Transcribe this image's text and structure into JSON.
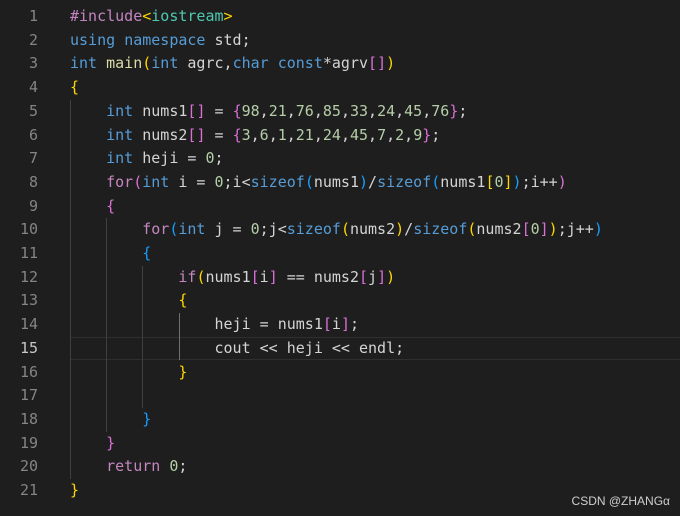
{
  "lines": [
    {
      "n": "1",
      "segs": [
        [
          "pp",
          "#include"
        ],
        [
          "b1",
          "<"
        ],
        [
          "ty",
          "iostream"
        ],
        [
          "b1",
          ">"
        ]
      ]
    },
    {
      "n": "2",
      "segs": [
        [
          "kw",
          "using"
        ],
        [
          "plain",
          " "
        ],
        [
          "kw",
          "namespace"
        ],
        [
          "plain",
          " std;"
        ]
      ]
    },
    {
      "n": "3",
      "segs": [
        [
          "kw",
          "int"
        ],
        [
          "plain",
          " "
        ],
        [
          "fn",
          "main"
        ],
        [
          "b1",
          "("
        ],
        [
          "kw",
          "int"
        ],
        [
          "plain",
          " agrc,"
        ],
        [
          "kw",
          "char"
        ],
        [
          "plain",
          " "
        ],
        [
          "kw",
          "const"
        ],
        [
          "plain",
          "*agrv"
        ],
        [
          "b2",
          "["
        ],
        [
          "b2",
          "]"
        ],
        [
          "b1",
          ")"
        ]
      ]
    },
    {
      "n": "4",
      "segs": [
        [
          "b1",
          "{"
        ]
      ]
    },
    {
      "n": "5",
      "segs": [
        [
          "plain",
          "    "
        ],
        [
          "kw",
          "int"
        ],
        [
          "plain",
          " nums1"
        ],
        [
          "b2",
          "["
        ],
        [
          "b2",
          "]"
        ],
        [
          "plain",
          " = "
        ],
        [
          "b2",
          "{"
        ],
        [
          "num",
          "98"
        ],
        [
          "plain",
          ","
        ],
        [
          "num",
          "21"
        ],
        [
          "plain",
          ","
        ],
        [
          "num",
          "76"
        ],
        [
          "plain",
          ","
        ],
        [
          "num",
          "85"
        ],
        [
          "plain",
          ","
        ],
        [
          "num",
          "33"
        ],
        [
          "plain",
          ","
        ],
        [
          "num",
          "24"
        ],
        [
          "plain",
          ","
        ],
        [
          "num",
          "45"
        ],
        [
          "plain",
          ","
        ],
        [
          "num",
          "76"
        ],
        [
          "b2",
          "}"
        ],
        [
          "plain",
          ";"
        ]
      ]
    },
    {
      "n": "6",
      "segs": [
        [
          "plain",
          "    "
        ],
        [
          "kw",
          "int"
        ],
        [
          "plain",
          " nums2"
        ],
        [
          "b2",
          "["
        ],
        [
          "b2",
          "]"
        ],
        [
          "plain",
          " = "
        ],
        [
          "b2",
          "{"
        ],
        [
          "num",
          "3"
        ],
        [
          "plain",
          ","
        ],
        [
          "num",
          "6"
        ],
        [
          "plain",
          ","
        ],
        [
          "num",
          "1"
        ],
        [
          "plain",
          ","
        ],
        [
          "num",
          "21"
        ],
        [
          "plain",
          ","
        ],
        [
          "num",
          "24"
        ],
        [
          "plain",
          ","
        ],
        [
          "num",
          "45"
        ],
        [
          "plain",
          ","
        ],
        [
          "num",
          "7"
        ],
        [
          "plain",
          ","
        ],
        [
          "num",
          "2"
        ],
        [
          "plain",
          ","
        ],
        [
          "num",
          "9"
        ],
        [
          "b2",
          "}"
        ],
        [
          "plain",
          ";"
        ]
      ]
    },
    {
      "n": "7",
      "segs": [
        [
          "plain",
          "    "
        ],
        [
          "kw",
          "int"
        ],
        [
          "plain",
          " heji = "
        ],
        [
          "num",
          "0"
        ],
        [
          "plain",
          ";"
        ]
      ]
    },
    {
      "n": "8",
      "segs": [
        [
          "plain",
          "    "
        ],
        [
          "ctl",
          "for"
        ],
        [
          "b2",
          "("
        ],
        [
          "kw",
          "int"
        ],
        [
          "plain",
          " i = "
        ],
        [
          "num",
          "0"
        ],
        [
          "plain",
          ";i<"
        ],
        [
          "kw",
          "sizeof"
        ],
        [
          "b3",
          "("
        ],
        [
          "plain",
          "nums1"
        ],
        [
          "b3",
          ")"
        ],
        [
          "plain",
          "/"
        ],
        [
          "kw",
          "sizeof"
        ],
        [
          "b3",
          "("
        ],
        [
          "plain",
          "nums1"
        ],
        [
          "b1",
          "["
        ],
        [
          "num",
          "0"
        ],
        [
          "b1",
          "]"
        ],
        [
          "b3",
          ")"
        ],
        [
          "plain",
          ";i++"
        ],
        [
          "b2",
          ")"
        ]
      ]
    },
    {
      "n": "9",
      "segs": [
        [
          "plain",
          "    "
        ],
        [
          "b2",
          "{"
        ]
      ]
    },
    {
      "n": "10",
      "segs": [
        [
          "plain",
          "        "
        ],
        [
          "ctl",
          "for"
        ],
        [
          "b3",
          "("
        ],
        [
          "kw",
          "int"
        ],
        [
          "plain",
          " j = "
        ],
        [
          "num",
          "0"
        ],
        [
          "plain",
          ";j<"
        ],
        [
          "kw",
          "sizeof"
        ],
        [
          "b1",
          "("
        ],
        [
          "plain",
          "nums2"
        ],
        [
          "b1",
          ")"
        ],
        [
          "plain",
          "/"
        ],
        [
          "kw",
          "sizeof"
        ],
        [
          "b1",
          "("
        ],
        [
          "plain",
          "nums2"
        ],
        [
          "b2",
          "["
        ],
        [
          "num",
          "0"
        ],
        [
          "b2",
          "]"
        ],
        [
          "b1",
          ")"
        ],
        [
          "plain",
          ";j++"
        ],
        [
          "b3",
          ")"
        ]
      ]
    },
    {
      "n": "11",
      "segs": [
        [
          "plain",
          "        "
        ],
        [
          "b3",
          "{"
        ]
      ]
    },
    {
      "n": "12",
      "segs": [
        [
          "plain",
          "            "
        ],
        [
          "ctl",
          "if"
        ],
        [
          "b1",
          "("
        ],
        [
          "plain",
          "nums1"
        ],
        [
          "b2",
          "["
        ],
        [
          "plain",
          "i"
        ],
        [
          "b2",
          "]"
        ],
        [
          "plain",
          " == nums2"
        ],
        [
          "b2",
          "["
        ],
        [
          "plain",
          "j"
        ],
        [
          "b2",
          "]"
        ],
        [
          "b1",
          ")"
        ]
      ]
    },
    {
      "n": "13",
      "segs": [
        [
          "plain",
          "            "
        ],
        [
          "b1",
          "{"
        ]
      ]
    },
    {
      "n": "14",
      "segs": [
        [
          "plain",
          "                heji = nums1"
        ],
        [
          "b2",
          "["
        ],
        [
          "plain",
          "i"
        ],
        [
          "b2",
          "]"
        ],
        [
          "plain",
          ";"
        ]
      ]
    },
    {
      "n": "15",
      "segs": [
        [
          "plain",
          "                cout << heji << endl;"
        ]
      ]
    },
    {
      "n": "16",
      "segs": [
        [
          "plain",
          "            "
        ],
        [
          "b1",
          "}"
        ]
      ]
    },
    {
      "n": "17",
      "segs": []
    },
    {
      "n": "18",
      "segs": [
        [
          "plain",
          "        "
        ],
        [
          "b3",
          "}"
        ]
      ]
    },
    {
      "n": "19",
      "segs": [
        [
          "plain",
          "    "
        ],
        [
          "b2",
          "}"
        ]
      ]
    },
    {
      "n": "20",
      "segs": [
        [
          "plain",
          "    "
        ],
        [
          "ctl",
          "return"
        ],
        [
          "plain",
          " "
        ],
        [
          "num",
          "0"
        ],
        [
          "plain",
          ";"
        ]
      ]
    },
    {
      "n": "21",
      "segs": [
        [
          "b1",
          "}"
        ]
      ]
    }
  ],
  "current_line": "15",
  "watermark": "CSDN @ZHANGα",
  "colors": {
    "background": "#1e1e1e",
    "line_number": "#858585",
    "keyword": "#569cd6",
    "control": "#c586c0",
    "function": "#dcdcaa",
    "number": "#b5cea8",
    "bracket1": "#ffd700",
    "bracket2": "#da70d6",
    "bracket3": "#179fff"
  }
}
